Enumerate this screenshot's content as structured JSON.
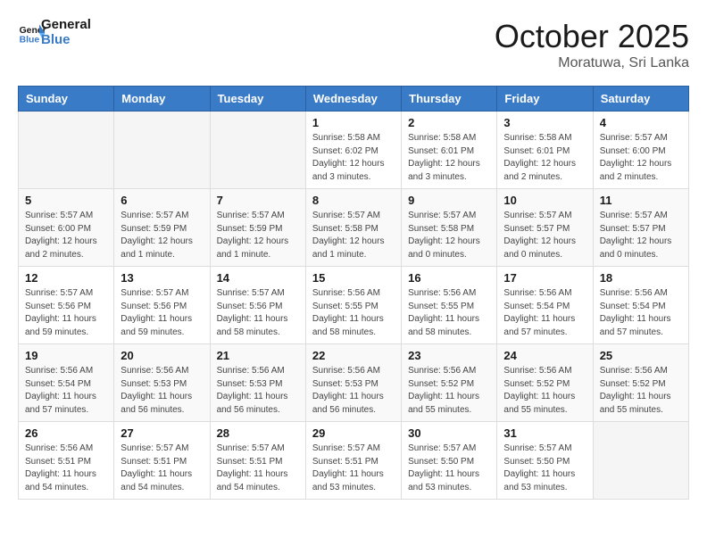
{
  "header": {
    "logo_line1": "General",
    "logo_line2": "Blue",
    "month": "October 2025",
    "location": "Moratuwa, Sri Lanka"
  },
  "weekdays": [
    "Sunday",
    "Monday",
    "Tuesday",
    "Wednesday",
    "Thursday",
    "Friday",
    "Saturday"
  ],
  "weeks": [
    [
      {
        "day": "",
        "info": ""
      },
      {
        "day": "",
        "info": ""
      },
      {
        "day": "",
        "info": ""
      },
      {
        "day": "1",
        "info": "Sunrise: 5:58 AM\nSunset: 6:02 PM\nDaylight: 12 hours\nand 3 minutes."
      },
      {
        "day": "2",
        "info": "Sunrise: 5:58 AM\nSunset: 6:01 PM\nDaylight: 12 hours\nand 3 minutes."
      },
      {
        "day": "3",
        "info": "Sunrise: 5:58 AM\nSunset: 6:01 PM\nDaylight: 12 hours\nand 2 minutes."
      },
      {
        "day": "4",
        "info": "Sunrise: 5:57 AM\nSunset: 6:00 PM\nDaylight: 12 hours\nand 2 minutes."
      }
    ],
    [
      {
        "day": "5",
        "info": "Sunrise: 5:57 AM\nSunset: 6:00 PM\nDaylight: 12 hours\nand 2 minutes."
      },
      {
        "day": "6",
        "info": "Sunrise: 5:57 AM\nSunset: 5:59 PM\nDaylight: 12 hours\nand 1 minute."
      },
      {
        "day": "7",
        "info": "Sunrise: 5:57 AM\nSunset: 5:59 PM\nDaylight: 12 hours\nand 1 minute."
      },
      {
        "day": "8",
        "info": "Sunrise: 5:57 AM\nSunset: 5:58 PM\nDaylight: 12 hours\nand 1 minute."
      },
      {
        "day": "9",
        "info": "Sunrise: 5:57 AM\nSunset: 5:58 PM\nDaylight: 12 hours\nand 0 minutes."
      },
      {
        "day": "10",
        "info": "Sunrise: 5:57 AM\nSunset: 5:57 PM\nDaylight: 12 hours\nand 0 minutes."
      },
      {
        "day": "11",
        "info": "Sunrise: 5:57 AM\nSunset: 5:57 PM\nDaylight: 12 hours\nand 0 minutes."
      }
    ],
    [
      {
        "day": "12",
        "info": "Sunrise: 5:57 AM\nSunset: 5:56 PM\nDaylight: 11 hours\nand 59 minutes."
      },
      {
        "day": "13",
        "info": "Sunrise: 5:57 AM\nSunset: 5:56 PM\nDaylight: 11 hours\nand 59 minutes."
      },
      {
        "day": "14",
        "info": "Sunrise: 5:57 AM\nSunset: 5:56 PM\nDaylight: 11 hours\nand 58 minutes."
      },
      {
        "day": "15",
        "info": "Sunrise: 5:56 AM\nSunset: 5:55 PM\nDaylight: 11 hours\nand 58 minutes."
      },
      {
        "day": "16",
        "info": "Sunrise: 5:56 AM\nSunset: 5:55 PM\nDaylight: 11 hours\nand 58 minutes."
      },
      {
        "day": "17",
        "info": "Sunrise: 5:56 AM\nSunset: 5:54 PM\nDaylight: 11 hours\nand 57 minutes."
      },
      {
        "day": "18",
        "info": "Sunrise: 5:56 AM\nSunset: 5:54 PM\nDaylight: 11 hours\nand 57 minutes."
      }
    ],
    [
      {
        "day": "19",
        "info": "Sunrise: 5:56 AM\nSunset: 5:54 PM\nDaylight: 11 hours\nand 57 minutes."
      },
      {
        "day": "20",
        "info": "Sunrise: 5:56 AM\nSunset: 5:53 PM\nDaylight: 11 hours\nand 56 minutes."
      },
      {
        "day": "21",
        "info": "Sunrise: 5:56 AM\nSunset: 5:53 PM\nDaylight: 11 hours\nand 56 minutes."
      },
      {
        "day": "22",
        "info": "Sunrise: 5:56 AM\nSunset: 5:53 PM\nDaylight: 11 hours\nand 56 minutes."
      },
      {
        "day": "23",
        "info": "Sunrise: 5:56 AM\nSunset: 5:52 PM\nDaylight: 11 hours\nand 55 minutes."
      },
      {
        "day": "24",
        "info": "Sunrise: 5:56 AM\nSunset: 5:52 PM\nDaylight: 11 hours\nand 55 minutes."
      },
      {
        "day": "25",
        "info": "Sunrise: 5:56 AM\nSunset: 5:52 PM\nDaylight: 11 hours\nand 55 minutes."
      }
    ],
    [
      {
        "day": "26",
        "info": "Sunrise: 5:56 AM\nSunset: 5:51 PM\nDaylight: 11 hours\nand 54 minutes."
      },
      {
        "day": "27",
        "info": "Sunrise: 5:57 AM\nSunset: 5:51 PM\nDaylight: 11 hours\nand 54 minutes."
      },
      {
        "day": "28",
        "info": "Sunrise: 5:57 AM\nSunset: 5:51 PM\nDaylight: 11 hours\nand 54 minutes."
      },
      {
        "day": "29",
        "info": "Sunrise: 5:57 AM\nSunset: 5:51 PM\nDaylight: 11 hours\nand 53 minutes."
      },
      {
        "day": "30",
        "info": "Sunrise: 5:57 AM\nSunset: 5:50 PM\nDaylight: 11 hours\nand 53 minutes."
      },
      {
        "day": "31",
        "info": "Sunrise: 5:57 AM\nSunset: 5:50 PM\nDaylight: 11 hours\nand 53 minutes."
      },
      {
        "day": "",
        "info": ""
      }
    ]
  ]
}
